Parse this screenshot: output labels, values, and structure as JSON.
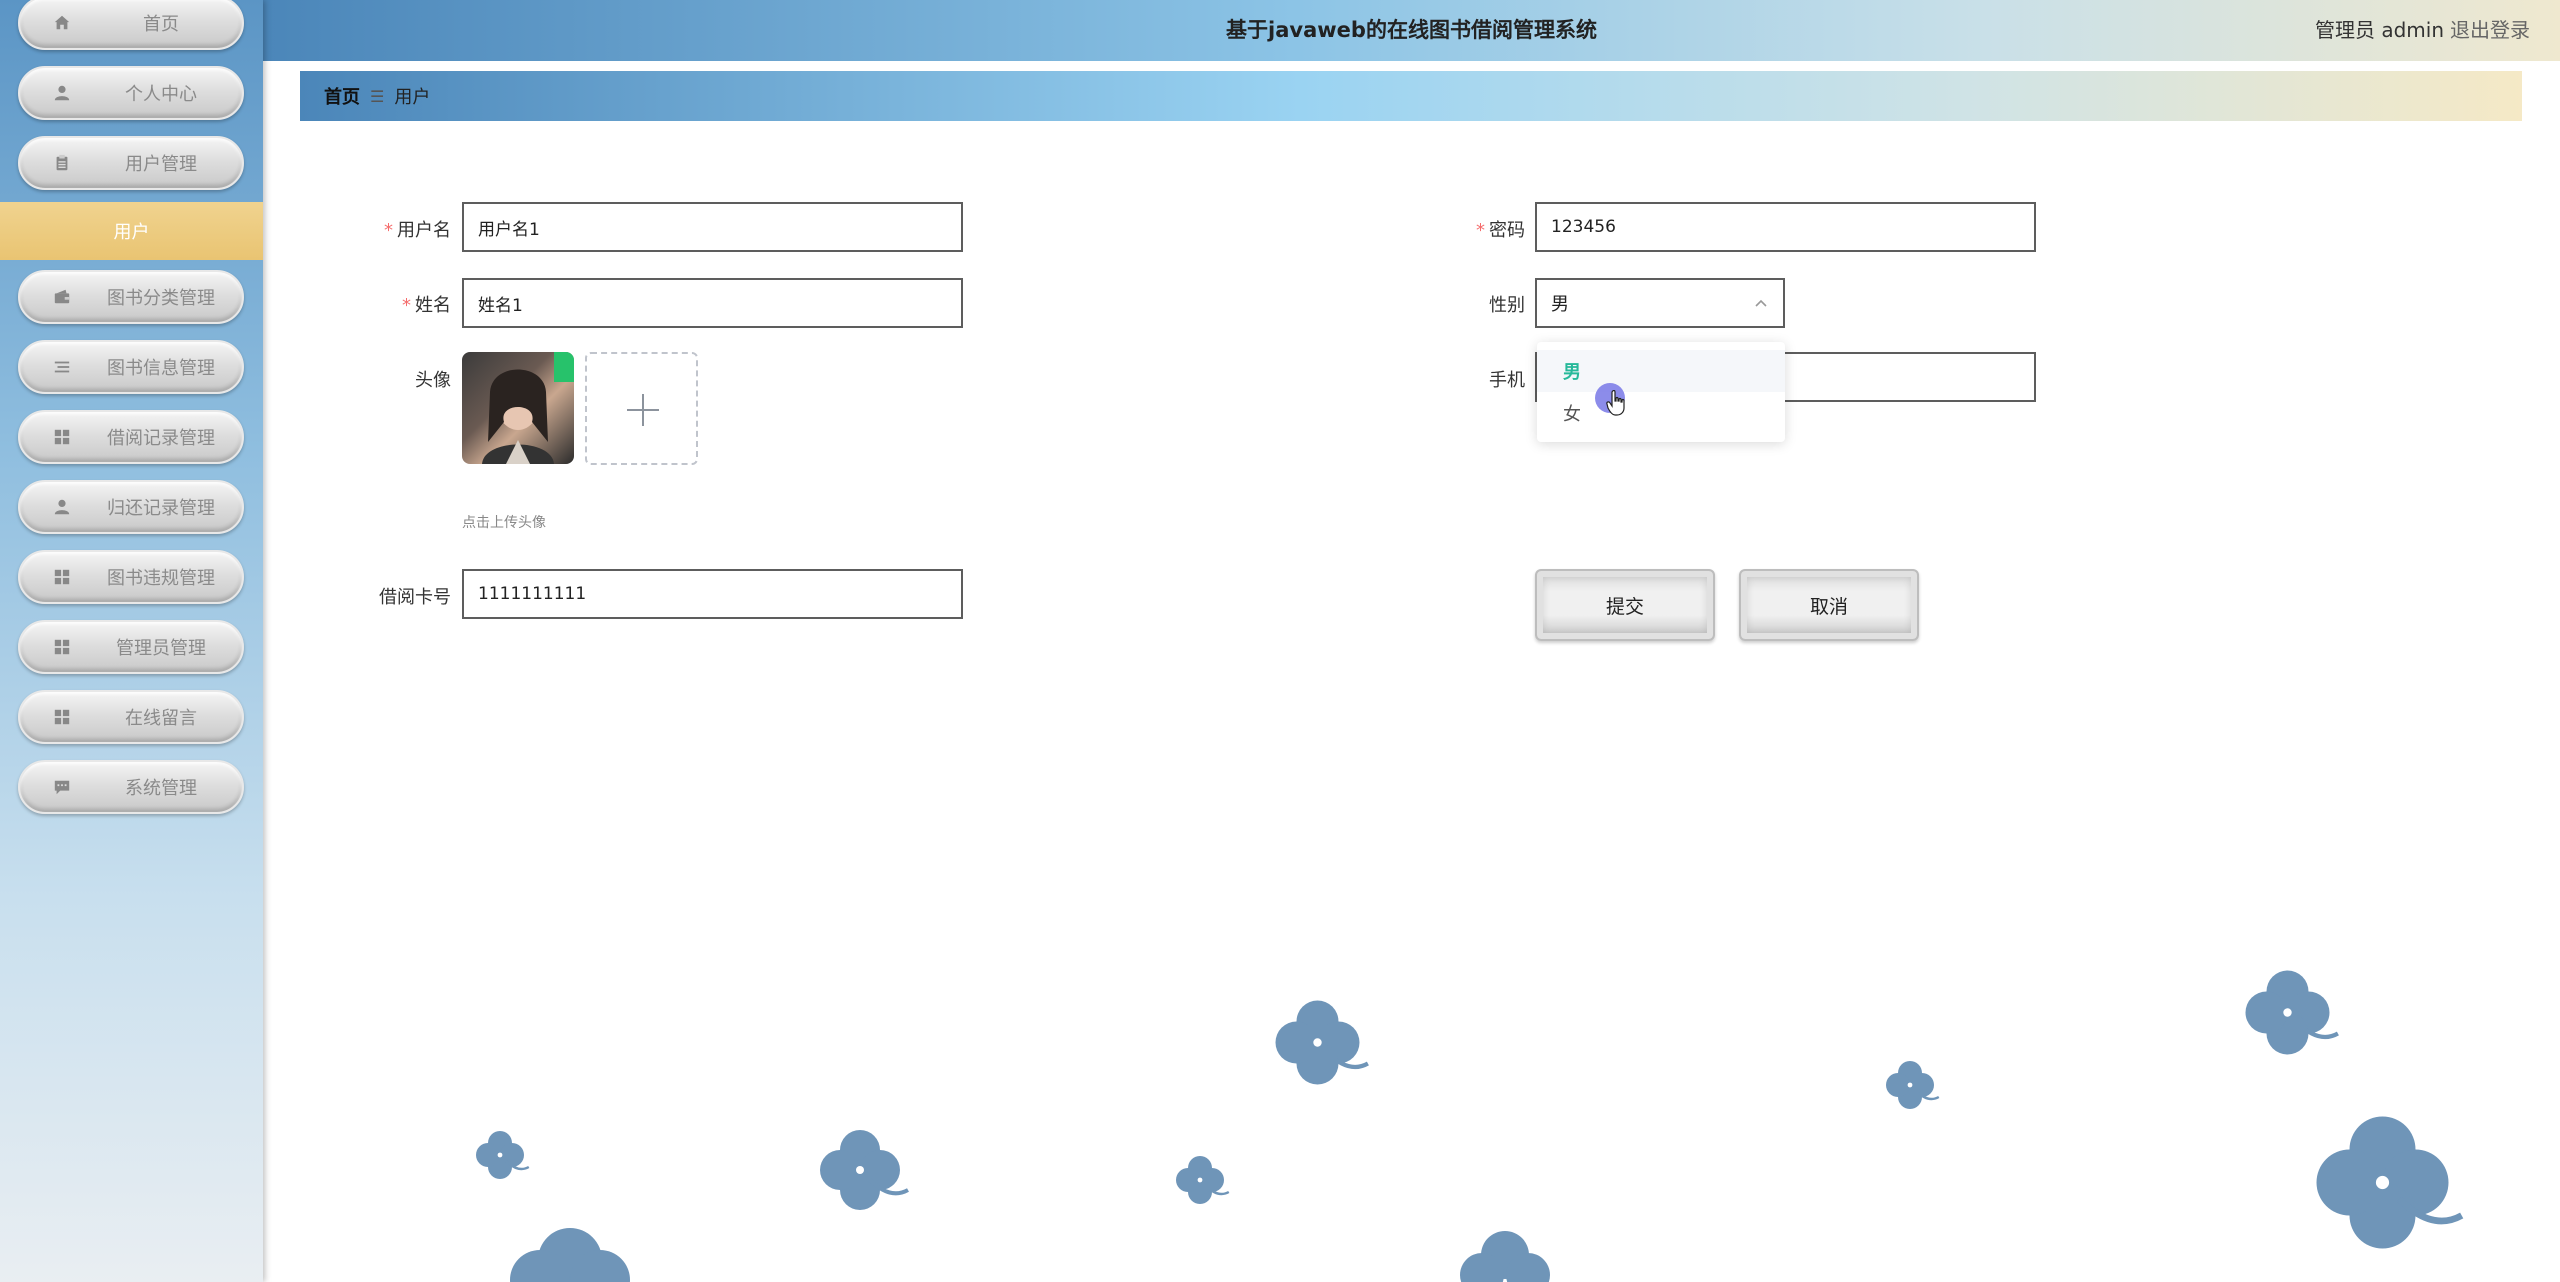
{
  "app": {
    "title": "基于javaweb的在线图书借阅管理系统",
    "user_label": "管理员 admin",
    "logout_label": "退出登录"
  },
  "sidebar": {
    "items": [
      {
        "label": "首页",
        "icon": "home-icon"
      },
      {
        "label": "个人中心",
        "icon": "user-icon"
      },
      {
        "label": "用户管理",
        "icon": "clipboard-icon"
      },
      {
        "label": "图书分类管理",
        "icon": "wallet-icon"
      },
      {
        "label": "图书信息管理",
        "icon": "list-icon"
      },
      {
        "label": "借阅记录管理",
        "icon": "grid-icon"
      },
      {
        "label": "归还记录管理",
        "icon": "user-icon"
      },
      {
        "label": "图书违规管理",
        "icon": "grid-icon"
      },
      {
        "label": "管理员管理",
        "icon": "grid-icon"
      },
      {
        "label": "在线留言",
        "icon": "grid-icon"
      },
      {
        "label": "系统管理",
        "icon": "chat-icon"
      }
    ],
    "active_sub": "用户"
  },
  "breadcrumb": {
    "home": "首页",
    "separator": "☰",
    "current": "用户"
  },
  "form": {
    "username": {
      "label": "用户名",
      "value": "用户名1"
    },
    "password": {
      "label": "密码",
      "value": "123456"
    },
    "name": {
      "label": "姓名",
      "value": "姓名1"
    },
    "gender": {
      "label": "性别",
      "value": "男",
      "options": [
        "男",
        "女"
      ]
    },
    "avatar": {
      "label": "头像",
      "tip": "点击上传头像"
    },
    "phone": {
      "label": "手机",
      "value": ""
    },
    "card": {
      "label": "借阅卡号",
      "value": "1111111111"
    },
    "submit_label": "提交",
    "cancel_label": "取消"
  },
  "colors": {
    "accent_selected": "#27b99a",
    "required": "#f56c6c",
    "submenu_active": "#e9c472"
  }
}
